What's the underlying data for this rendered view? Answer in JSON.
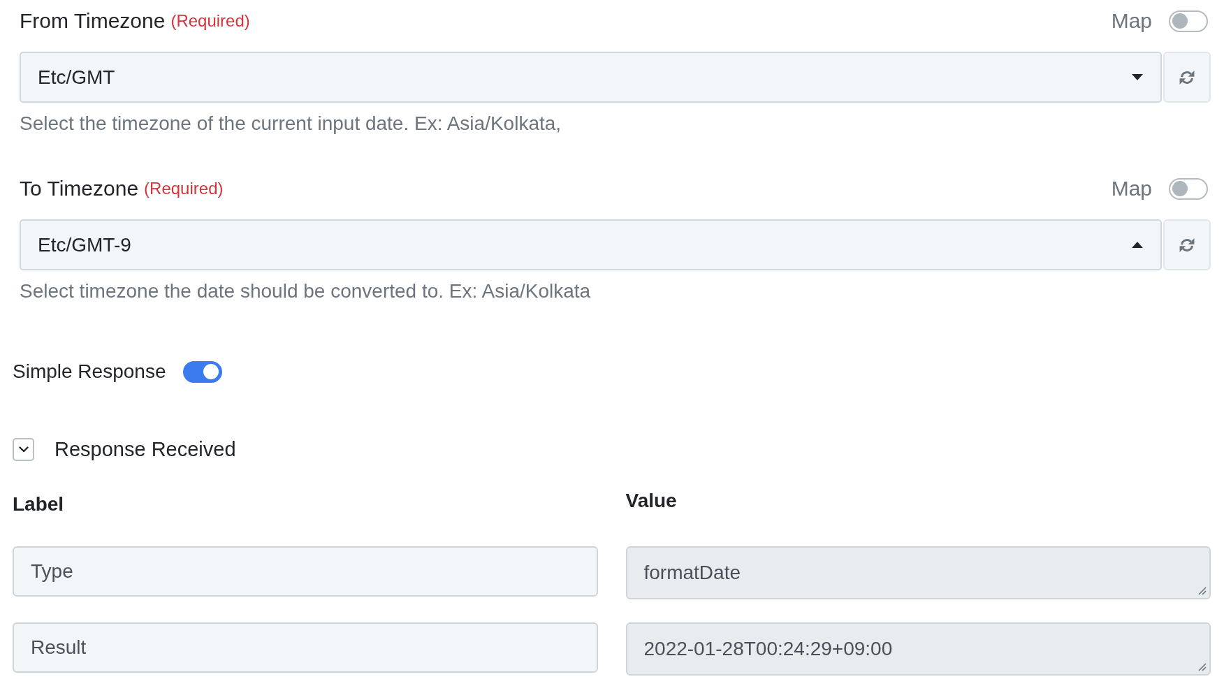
{
  "timezone_fields": [
    {
      "label": "From Timezone",
      "required_note": "(Required)",
      "map": {
        "label": "Map",
        "on": false
      },
      "value": "Etc/GMT",
      "expanded": false,
      "help": "Select the timezone of the current input date. Ex: Asia/Kolkata,"
    },
    {
      "label": "To Timezone",
      "required_note": "(Required)",
      "map": {
        "label": "Map",
        "on": false
      },
      "value": "Etc/GMT-9",
      "expanded": true,
      "help": "Select timezone the date should be converted to. Ex: Asia/Kolkata"
    }
  ],
  "simple_response": {
    "label": "Simple Response",
    "on": true
  },
  "response_received": {
    "title": "Response Received",
    "expanded": true,
    "columns": [
      "Label",
      "Value"
    ],
    "rows": [
      {
        "label": "Type",
        "value": "formatDate"
      },
      {
        "label": "Result",
        "value": "2022-01-28T00:24:29+09:00"
      }
    ]
  }
}
